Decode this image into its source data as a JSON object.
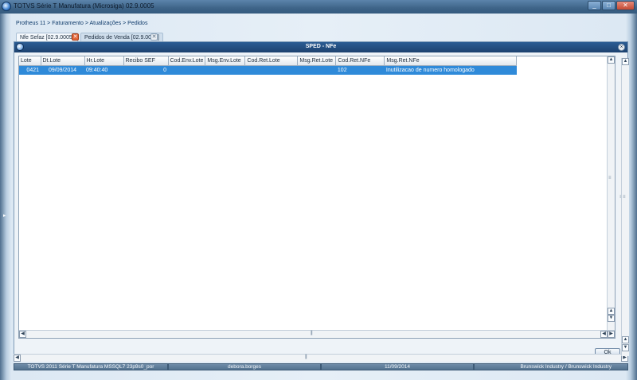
{
  "window": {
    "title": "TOTVS Série T Manufatura (Microsiga) 02.9.0005",
    "minimize": "_",
    "maximize": "□",
    "close": "✕"
  },
  "breadcrumb": "Protheus 11 > Faturamento > Atualizações > Pedidos",
  "tabs": [
    {
      "label": "Nfe Sefaz [02.9.0005]",
      "close": "✕"
    },
    {
      "label": "Pedidos de Venda [02.9.0005]",
      "close": "✕"
    }
  ],
  "dialog": {
    "title": "SPED - NFe",
    "columns": [
      "Lote",
      "Dt.Lote",
      "Hr.Lote",
      "Recibo SEF",
      "Cod.Env.Lote",
      "Msg.Env.Lote",
      "Cod.Ret.Lote",
      "Msg.Ret.Lote",
      "Cod.Ret.NFe",
      "Msg.Ret.NFe"
    ],
    "rows": [
      [
        "0421",
        "09/09/2014",
        "09:40:40",
        "0",
        "",
        "",
        "",
        "",
        "102",
        "Inutilizacao de numero homologado"
      ]
    ],
    "ok_label": "Ok"
  },
  "status": {
    "version": "TOTVS 2011 Série T Manufatura MSSQL7 23p9s0_por",
    "user": "debora.borges",
    "date": "11/09/2014",
    "company": "Brunswick Industry / Brunswick Industry"
  },
  "colors": {
    "titlebar": "#3e6488",
    "dialog_header": "#1d426f",
    "selection": "#2f8ad9",
    "close_tab": "#e2663a"
  }
}
